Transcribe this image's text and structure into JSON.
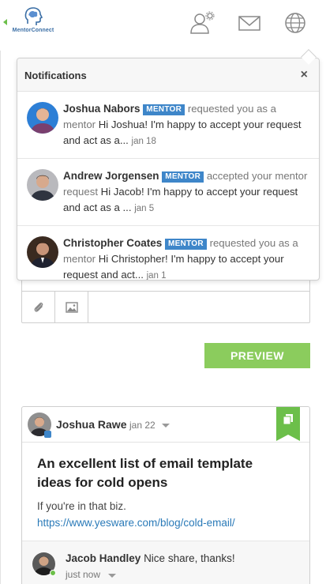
{
  "header": {
    "logo_text": "MentorConnect",
    "icons": [
      "user-settings-icon",
      "mail-icon",
      "globe-icon"
    ]
  },
  "colors": {
    "accent_green": "#8bcc5d",
    "badge_blue": "#3e86c9",
    "link_blue": "#2a7ab8"
  },
  "notifications": {
    "title": "Notifications",
    "close_label": "×",
    "items": [
      {
        "name": "Joshua Nabors",
        "badge": "MENTOR",
        "action": "requested you as a mentor",
        "message": "Hi Joshua! I'm happy to accept your request and act as a...",
        "date": "jan 18"
      },
      {
        "name": "Andrew Jorgensen",
        "badge": "MENTOR",
        "action": "accepted your mentor request",
        "message": "Hi Jacob! I'm happy to accept your request and act as a ...",
        "date": "jan 5"
      },
      {
        "name": "Christopher Coates",
        "badge": "MENTOR",
        "action": "requested you as a mentor",
        "message": "Hi Christopher! I'm happy to accept your request and act...",
        "date": "jan 1"
      }
    ]
  },
  "editor": {
    "tools": [
      "paperclip-icon",
      "image-icon"
    ]
  },
  "preview_button": "PREVIEW",
  "post": {
    "author": "Joshua Rawe",
    "date": "jan 22",
    "title": "An excellent list of email template ideas for cold opens",
    "body": "If you're in that biz.",
    "link": "https://www.yesware.com/blog/cold-email/",
    "comment": {
      "name": "Jacob Handley",
      "text": "Nice share, thanks!",
      "time": "just now"
    }
  }
}
